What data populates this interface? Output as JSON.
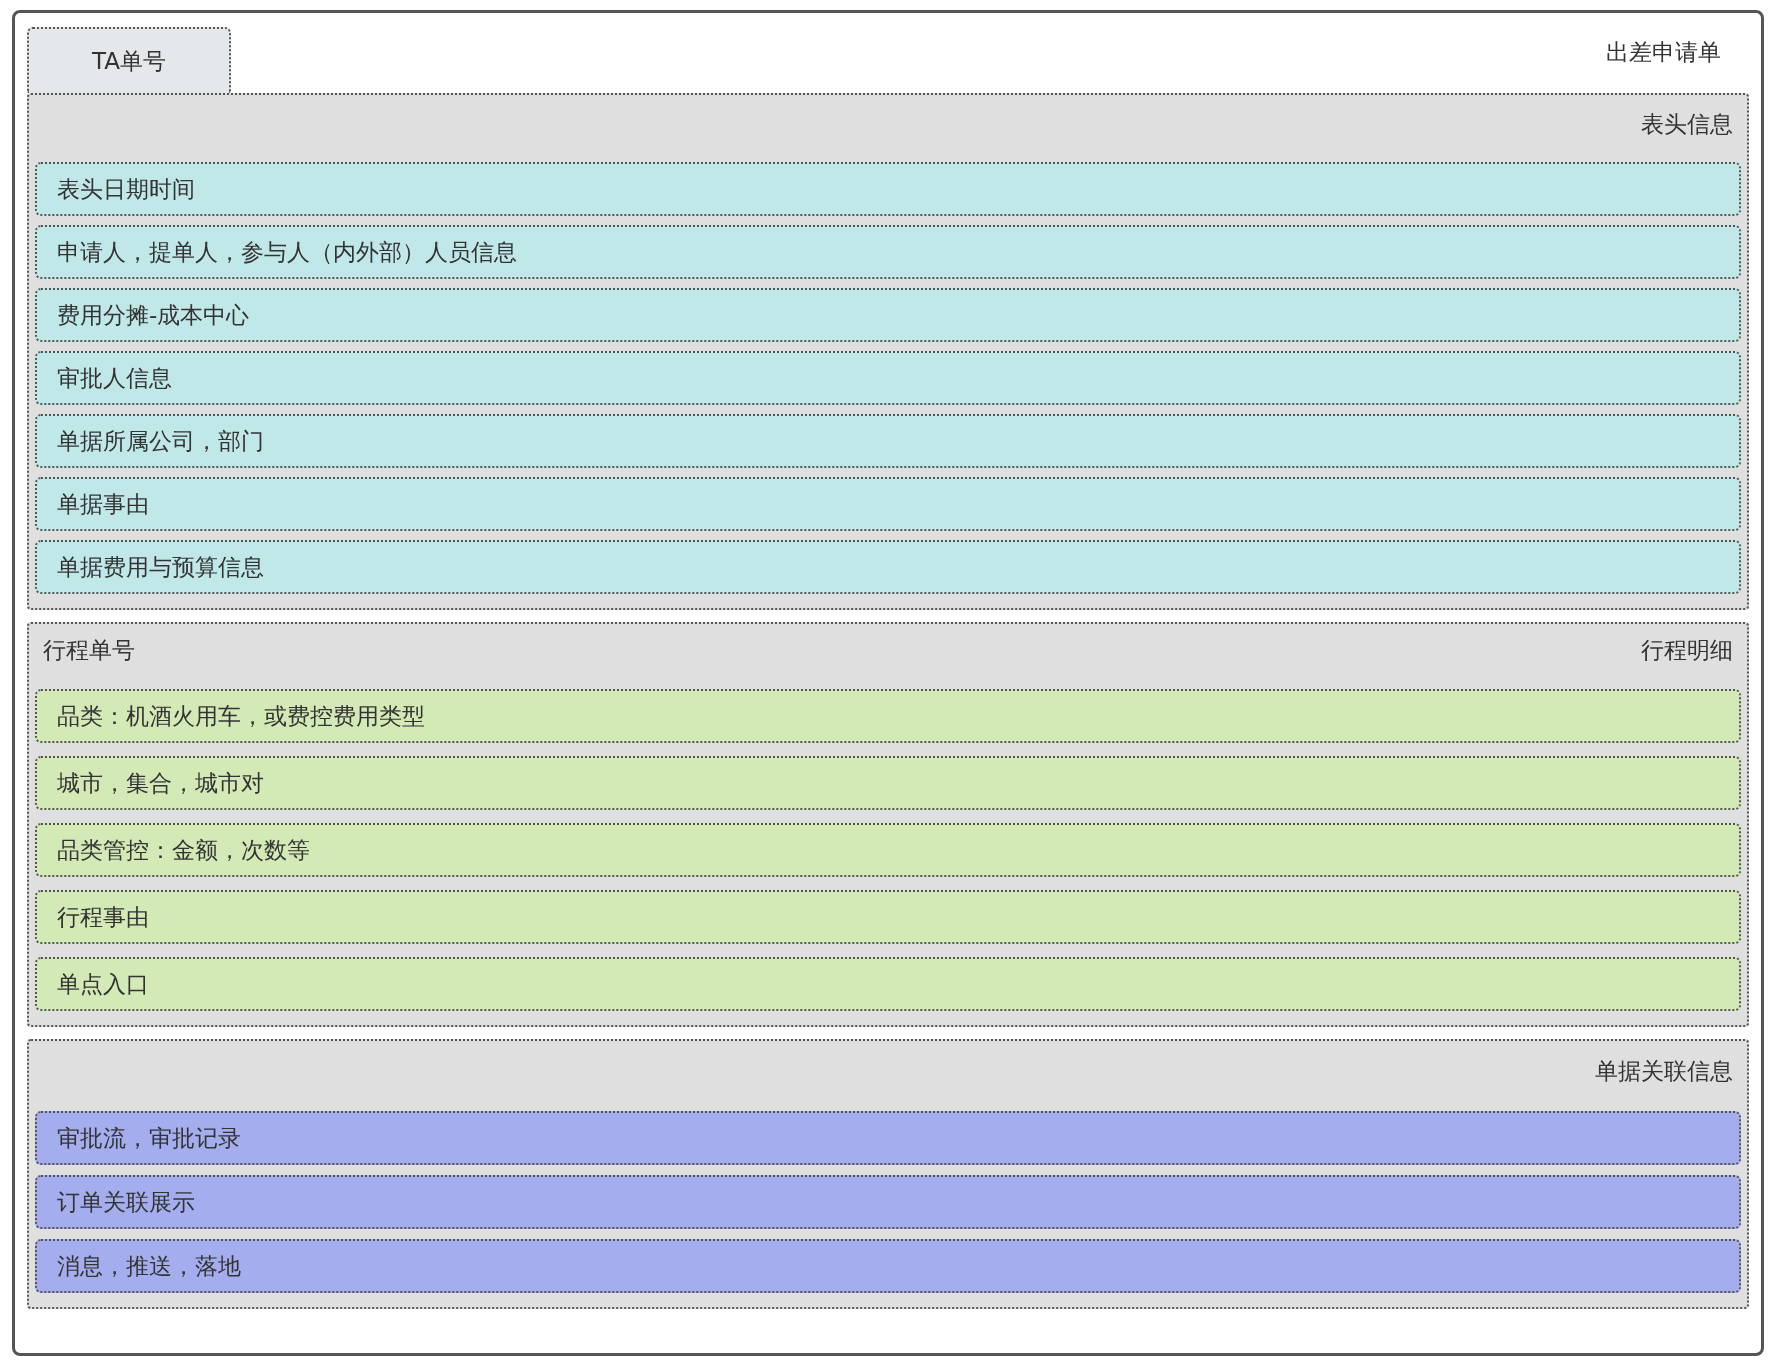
{
  "tab": {
    "label": "TA单号"
  },
  "title": "出差申请单",
  "sections": [
    {
      "title_right": "表头信息",
      "color": "#c0e8e8",
      "items": [
        "表头日期时间",
        "申请人，提单人，参与人（内外部）人员信息",
        "费用分摊-成本中心",
        "审批人信息",
        "单据所属公司，部门",
        "单据事由",
        "单据费用与预算信息"
      ]
    },
    {
      "title_left": "行程单号",
      "title_right": "行程明细",
      "color": "#d3eab7",
      "items": [
        "品类：机酒火用车，或费控费用类型",
        "城市，集合，城市对",
        "品类管控：金额，次数等",
        "行程事由",
        "单点入口"
      ]
    },
    {
      "title_right": "单据关联信息",
      "color": "#a4aded",
      "items": [
        "审批流，审批记录",
        "订单关联展示",
        "消息，推送，落地"
      ]
    }
  ]
}
